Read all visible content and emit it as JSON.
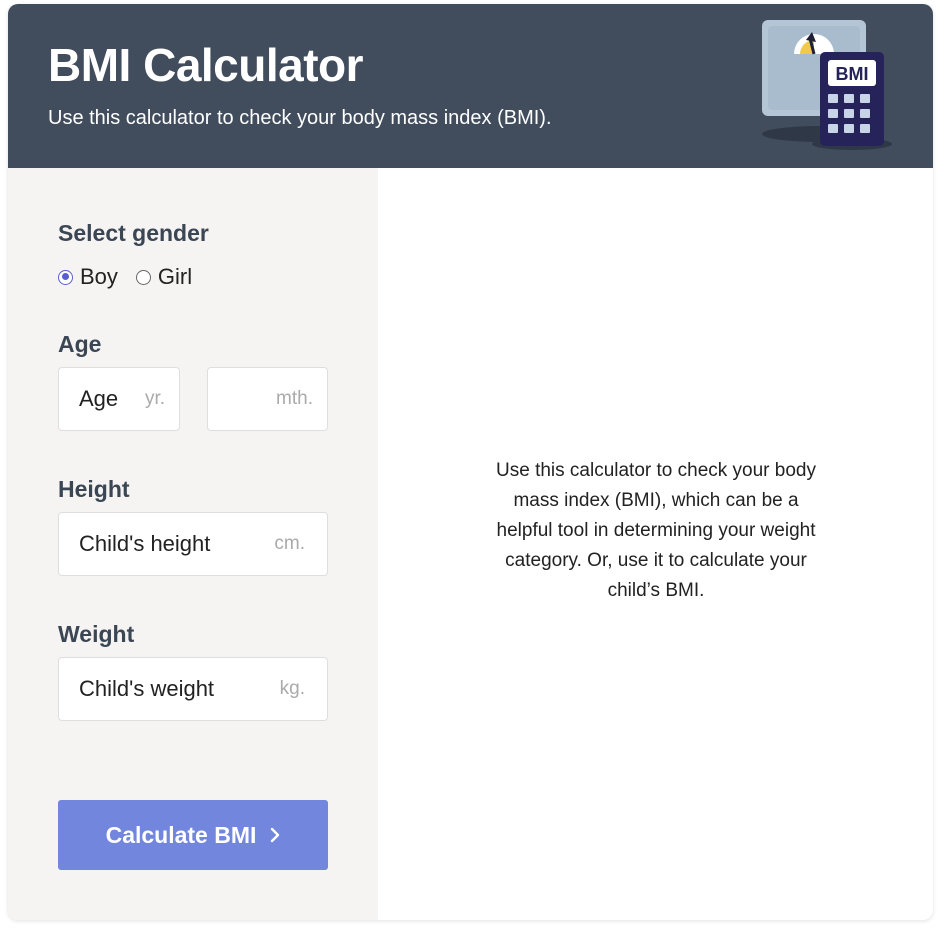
{
  "header": {
    "title": "BMI Calculator",
    "subtitle": "Use this calculator to check your body mass index (BMI).",
    "illustration_icon": "bmi-scale-calculator-icon",
    "calculator_screen_text": "BMI"
  },
  "form": {
    "gender": {
      "label": "Select gender",
      "options": [
        "Boy",
        "Girl"
      ],
      "selected": "Boy"
    },
    "age": {
      "label": "Age",
      "years_value": "Age",
      "years_unit": "yr.",
      "months_value": "",
      "months_unit": "mth."
    },
    "height": {
      "label": "Height",
      "value": "Child's height",
      "unit": "cm."
    },
    "weight": {
      "label": "Weight",
      "value": "Child's weight",
      "unit": "kg."
    },
    "submit": {
      "label": "Calculate BMI",
      "icon": "chevron-right-icon"
    }
  },
  "info": {
    "text": "Use this calculator to check your body mass index (BMI), which can be a helpful tool in determining your weight category. Or, use it to calculate your child’s BMI."
  },
  "colors": {
    "header_bg": "#414c5c",
    "panel_bg": "#f5f4f2",
    "accent": "#7186dc",
    "radio_selected": "#5a5fd0"
  }
}
